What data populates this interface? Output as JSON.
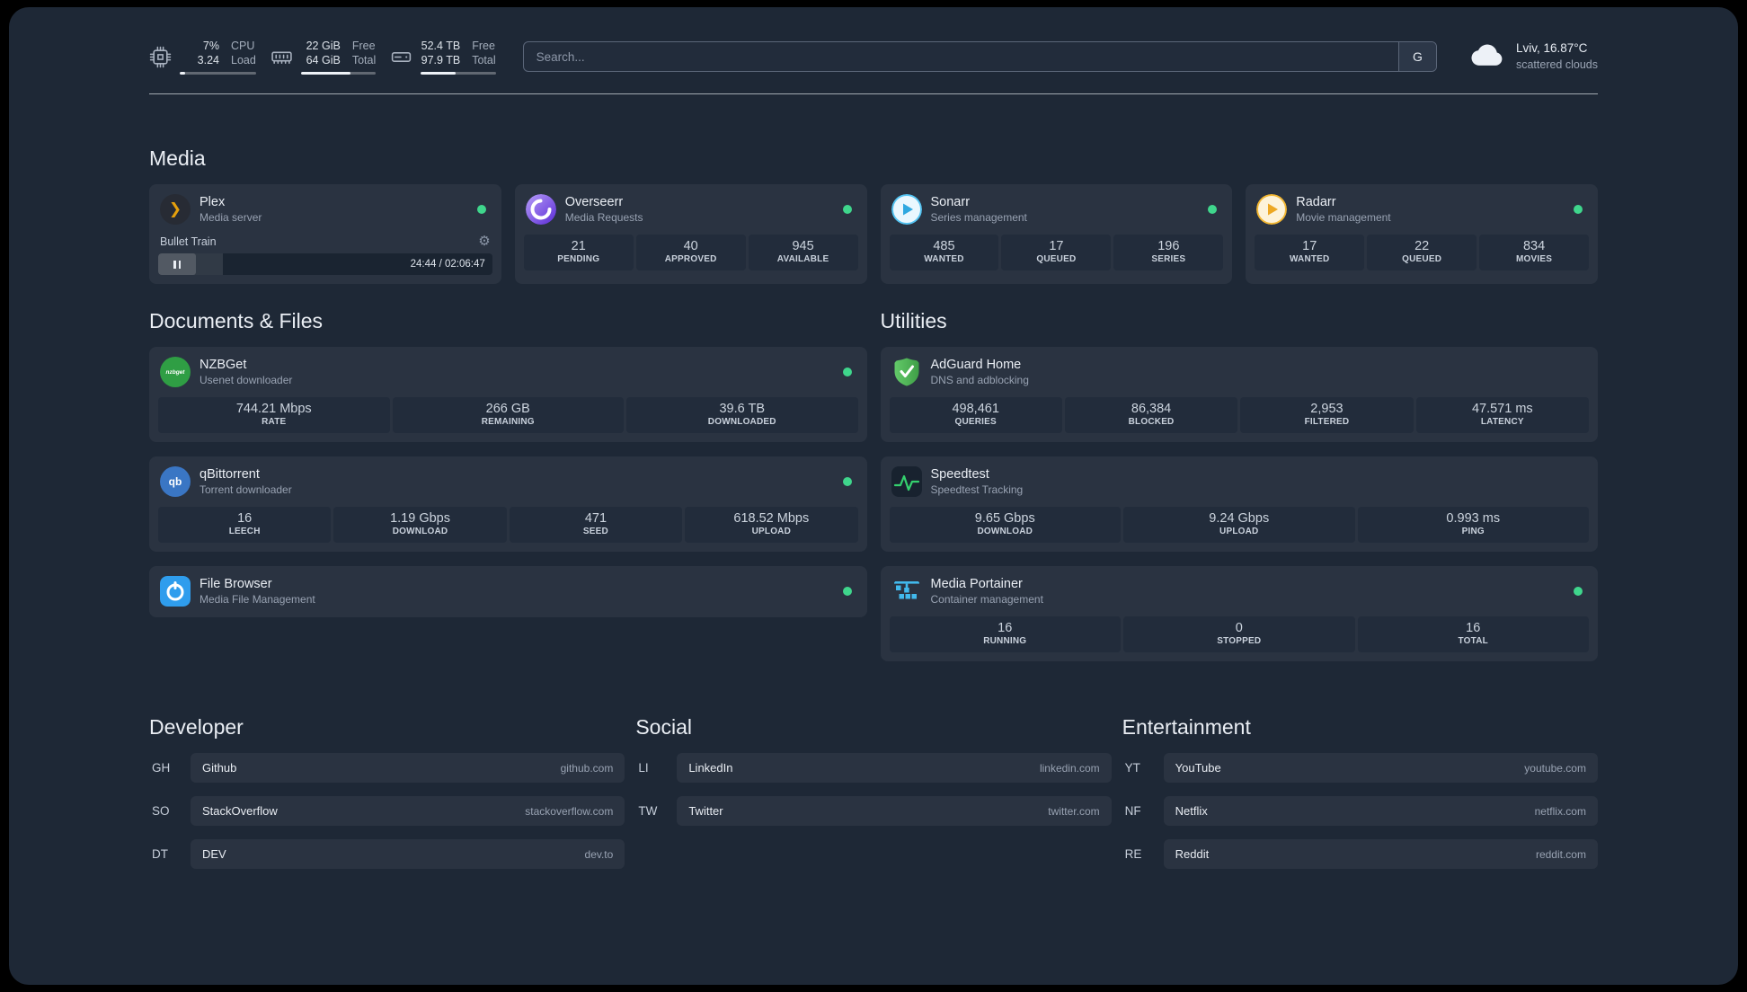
{
  "topbar": {
    "cpu": {
      "value": "7%",
      "sub": "3.24",
      "label_top": "CPU",
      "label_bottom": "Load",
      "progress": 7
    },
    "memory": {
      "value": "22 GiB",
      "sub": "64 GiB",
      "label_top": "Free",
      "label_bottom": "Total",
      "progress": 66
    },
    "disk": {
      "value": "52.4 TB",
      "sub": "97.9 TB",
      "label_top": "Free",
      "label_bottom": "Total",
      "progress": 47
    },
    "search": {
      "placeholder": "Search...",
      "engine_label": "G"
    },
    "weather": {
      "location": "Lviv, 16.87°C",
      "condition": "scattered clouds"
    }
  },
  "icons": {
    "plex_chevron": "❯",
    "settings_gear": "⚙",
    "qbittorrent_text": "qb",
    "nzbget_text": "nzbget"
  },
  "colors": {
    "status_online": "#3fd68c",
    "accent_plex": "#e5a00d",
    "background": "#1e2836"
  },
  "media": {
    "title": "Media",
    "plex": {
      "name": "Plex",
      "desc": "Media server",
      "player": {
        "title": "Bullet Train",
        "time": "24:44 / 02:06:47",
        "progress": 19.5
      }
    },
    "overseerr": {
      "name": "Overseerr",
      "desc": "Media Requests",
      "stats": [
        {
          "value": "21",
          "label": "PENDING"
        },
        {
          "value": "40",
          "label": "APPROVED"
        },
        {
          "value": "945",
          "label": "AVAILABLE"
        }
      ]
    },
    "sonarr": {
      "name": "Sonarr",
      "desc": "Series management",
      "stats": [
        {
          "value": "485",
          "label": "WANTED"
        },
        {
          "value": "17",
          "label": "QUEUED"
        },
        {
          "value": "196",
          "label": "SERIES"
        }
      ]
    },
    "radarr": {
      "name": "Radarr",
      "desc": "Movie management",
      "stats": [
        {
          "value": "17",
          "label": "WANTED"
        },
        {
          "value": "22",
          "label": "QUEUED"
        },
        {
          "value": "834",
          "label": "MOVIES"
        }
      ]
    }
  },
  "documents": {
    "title": "Documents & Files",
    "nzbget": {
      "name": "NZBGet",
      "desc": "Usenet downloader",
      "stats": [
        {
          "value": "744.21 Mbps",
          "label": "RATE"
        },
        {
          "value": "266 GB",
          "label": "REMAINING"
        },
        {
          "value": "39.6 TB",
          "label": "DOWNLOADED"
        }
      ]
    },
    "qbittorrent": {
      "name": "qBittorrent",
      "desc": "Torrent downloader",
      "stats": [
        {
          "value": "16",
          "label": "LEECH"
        },
        {
          "value": "1.19 Gbps",
          "label": "DOWNLOAD"
        },
        {
          "value": "471",
          "label": "SEED"
        },
        {
          "value": "618.52 Mbps",
          "label": "UPLOAD"
        }
      ]
    },
    "filebrowser": {
      "name": "File Browser",
      "desc": "Media File Management"
    }
  },
  "utilities": {
    "title": "Utilities",
    "adguard": {
      "name": "AdGuard Home",
      "desc": "DNS and adblocking",
      "stats": [
        {
          "value": "498,461",
          "label": "QUERIES"
        },
        {
          "value": "86,384",
          "label": "BLOCKED"
        },
        {
          "value": "2,953",
          "label": "FILTERED"
        },
        {
          "value": "47.571 ms",
          "label": "LATENCY"
        }
      ]
    },
    "speedtest": {
      "name": "Speedtest",
      "desc": "Speedtest Tracking",
      "stats": [
        {
          "value": "9.65 Gbps",
          "label": "DOWNLOAD"
        },
        {
          "value": "9.24 Gbps",
          "label": "UPLOAD"
        },
        {
          "value": "0.993 ms",
          "label": "PING"
        }
      ]
    },
    "portainer": {
      "name": "Media Portainer",
      "desc": "Container management",
      "stats": [
        {
          "value": "16",
          "label": "RUNNING"
        },
        {
          "value": "0",
          "label": "STOPPED"
        },
        {
          "value": "16",
          "label": "TOTAL"
        }
      ]
    }
  },
  "bookmarks": {
    "developer": {
      "title": "Developer",
      "items": [
        {
          "abbr": "GH",
          "name": "Github",
          "url": "github.com"
        },
        {
          "abbr": "SO",
          "name": "StackOverflow",
          "url": "stackoverflow.com"
        },
        {
          "abbr": "DT",
          "name": "DEV",
          "url": "dev.to"
        }
      ]
    },
    "social": {
      "title": "Social",
      "items": [
        {
          "abbr": "LI",
          "name": "LinkedIn",
          "url": "linkedin.com"
        },
        {
          "abbr": "TW",
          "name": "Twitter",
          "url": "twitter.com"
        }
      ]
    },
    "entertainment": {
      "title": "Entertainment",
      "items": [
        {
          "abbr": "YT",
          "name": "YouTube",
          "url": "youtube.com"
        },
        {
          "abbr": "NF",
          "name": "Netflix",
          "url": "netflix.com"
        },
        {
          "abbr": "RE",
          "name": "Reddit",
          "url": "reddit.com"
        }
      ]
    }
  }
}
